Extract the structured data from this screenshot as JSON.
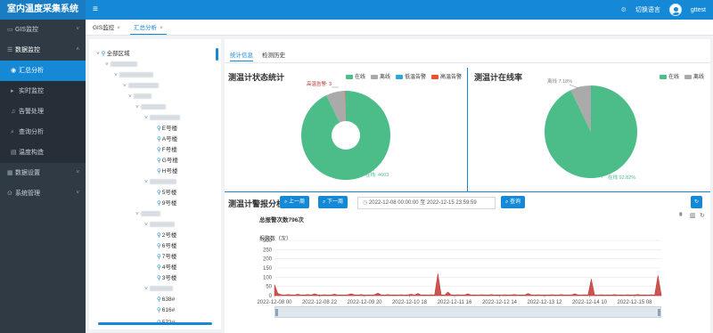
{
  "app": {
    "title": "室内温度采集系统",
    "language_label": "切换语言",
    "username": "gttest"
  },
  "sidebar": {
    "items": [
      {
        "label": "GIS监控",
        "icon": "monitor-icon"
      },
      {
        "label": "数据监控",
        "icon": "list-icon",
        "expanded": true,
        "children": [
          {
            "label": "汇总分析",
            "icon": "pin-icon",
            "active": true
          },
          {
            "label": "实时监控",
            "icon": "play-icon"
          },
          {
            "label": "告警处理",
            "icon": "bell-icon"
          },
          {
            "label": "查询分析",
            "icon": "search-icon"
          },
          {
            "label": "温度构造",
            "icon": "gear-icon"
          }
        ]
      },
      {
        "label": "数据设置",
        "icon": "chart-icon"
      },
      {
        "label": "系统管理",
        "icon": "settings-icon"
      }
    ]
  },
  "tabs": [
    {
      "label": "GIS监控",
      "active": false
    },
    {
      "label": "汇总分析",
      "active": true
    }
  ],
  "tree": {
    "root": "全部区域",
    "buildings_group1": [
      "E号楼",
      "A号楼",
      "F号楼",
      "G号楼",
      "H号楼"
    ],
    "buildings_group2": [
      "5号楼",
      "9号楼"
    ],
    "buildings_group3": [
      "2号楼",
      "6号楼",
      "7号楼",
      "4号楼",
      "3号楼"
    ],
    "buildings_group4": [
      "638#",
      "616#",
      "572#"
    ]
  },
  "subtabs": [
    {
      "label": "统计信息",
      "active": true
    },
    {
      "label": "检测历史",
      "active": false
    }
  ],
  "status_panel": {
    "title": "测温计状态统计",
    "legend": [
      {
        "label": "在线",
        "color": "#4cbd88"
      },
      {
        "label": "离线",
        "color": "#aaaaaa"
      },
      {
        "label": "低温告警",
        "color": "#29a8e0"
      },
      {
        "label": "高温告警",
        "color": "#e8532d"
      }
    ],
    "online_label": "在线: 4603",
    "online_value": 4603,
    "offline_fraction": 0.072,
    "alarm_label": "高温告警: 3"
  },
  "rate_panel": {
    "title": "测温计在线率",
    "legend": [
      {
        "label": "在线",
        "color": "#4cbd88"
      },
      {
        "label": "离线",
        "color": "#aaaaaa"
      }
    ],
    "online_label": "在线 92.82%",
    "offline_label": "离线 7.18%",
    "online_pct": 92.82,
    "offline_pct": 7.18
  },
  "alarm_panel": {
    "title": "测温计警报分析",
    "prev_label": "上一周",
    "next_label": "下一周",
    "start": "2022-12-08 00:00:00",
    "sep": "至",
    "end": "2022-12-15 23:59:59",
    "query_label": "查询",
    "refresh_icon": "refresh-icon"
  },
  "chart_data": {
    "type": "area",
    "title": "总报警次数796次",
    "ylabel": "报警数（次）",
    "ylim": [
      0,
      300
    ],
    "yticks": [
      0,
      50,
      100,
      150,
      200,
      250,
      300
    ],
    "xticks": [
      "2022-12-08 00",
      "2022-12-08 22",
      "2022-12-09 20",
      "2022-12-10 18",
      "2022-12-11 16",
      "2022-12-12 14",
      "2022-12-13 12",
      "2022-12-14 10",
      "2022-12-15 08"
    ],
    "series": [
      {
        "color": "#c23531",
        "values": [
          60,
          12,
          5,
          3,
          6,
          4,
          3,
          8,
          3,
          4,
          6,
          3,
          10,
          4,
          3,
          5,
          3,
          4,
          8,
          3,
          4,
          3,
          5,
          10,
          4,
          3,
          6,
          3,
          4,
          3,
          5,
          14,
          4,
          3,
          6,
          3,
          4,
          3,
          5,
          3,
          4,
          8,
          3,
          12,
          3,
          4,
          3,
          5,
          3,
          120,
          4,
          3,
          20,
          4,
          3,
          5,
          3,
          4,
          10,
          3,
          4,
          3,
          5,
          4,
          3,
          6,
          3,
          4,
          3,
          5,
          3,
          4,
          6,
          3,
          4,
          3,
          12,
          4,
          3,
          5,
          3,
          4,
          3,
          5,
          4,
          3,
          6,
          3,
          4,
          3,
          10,
          4,
          3,
          5,
          3,
          90,
          4,
          3,
          5,
          3,
          4,
          3,
          6,
          3,
          4,
          3,
          5,
          3,
          4,
          6,
          3,
          4,
          3,
          5,
          3,
          110,
          3
        ]
      }
    ]
  }
}
